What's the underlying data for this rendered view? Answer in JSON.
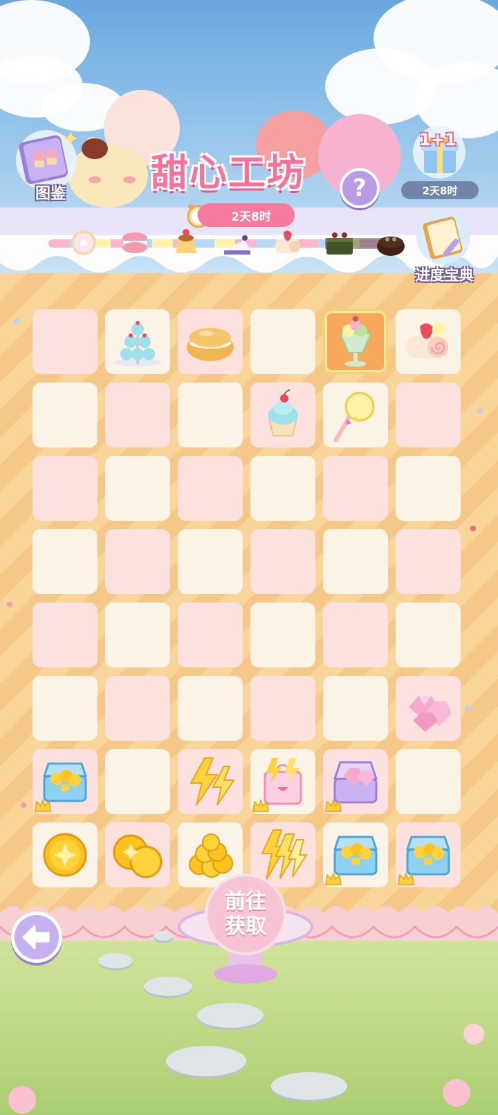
{
  "header": {
    "title": "甜心工坊",
    "help_icon": "?",
    "timer_text": "2天8时",
    "codex_label": "图鉴",
    "gift_label": "1+1",
    "gift_timer": "2天8时",
    "guide_label": "进度宝典"
  },
  "progress": {
    "stages": [
      "donut",
      "macaron",
      "pudding",
      "blueberry-cake",
      "strawberry-roll",
      "matcha-cake",
      "chocolate-cake"
    ],
    "unlocked_count": 5
  },
  "board": {
    "rows": [
      [
        {
          "c": "pink",
          "item": ""
        },
        {
          "c": "cream",
          "item": "cupcake-tower"
        },
        {
          "c": "pink",
          "item": "cream-puff"
        },
        {
          "c": "cream",
          "item": ""
        },
        {
          "c": "selected",
          "item": "parfait"
        },
        {
          "c": "cream",
          "item": "strawberry-roll"
        }
      ],
      [
        {
          "c": "cream",
          "item": ""
        },
        {
          "c": "pink",
          "item": ""
        },
        {
          "c": "cream",
          "item": ""
        },
        {
          "c": "pink",
          "item": "cupcake"
        },
        {
          "c": "cream",
          "item": "lollipop-wand"
        },
        {
          "c": "pink",
          "item": ""
        }
      ],
      [
        {
          "c": "pink",
          "item": ""
        },
        {
          "c": "cream",
          "item": ""
        },
        {
          "c": "pink",
          "item": ""
        },
        {
          "c": "cream",
          "item": ""
        },
        {
          "c": "pink",
          "item": ""
        },
        {
          "c": "cream",
          "item": ""
        }
      ],
      [
        {
          "c": "cream",
          "item": ""
        },
        {
          "c": "pink",
          "item": ""
        },
        {
          "c": "cream",
          "item": ""
        },
        {
          "c": "pink",
          "item": ""
        },
        {
          "c": "cream",
          "item": ""
        },
        {
          "c": "pink",
          "item": ""
        }
      ],
      [
        {
          "c": "pink",
          "item": ""
        },
        {
          "c": "cream",
          "item": ""
        },
        {
          "c": "pink",
          "item": ""
        },
        {
          "c": "cream",
          "item": ""
        },
        {
          "c": "pink",
          "item": ""
        },
        {
          "c": "cream",
          "item": ""
        }
      ],
      [
        {
          "c": "cream",
          "item": ""
        },
        {
          "c": "pink",
          "item": ""
        },
        {
          "c": "cream",
          "item": ""
        },
        {
          "c": "pink",
          "item": ""
        },
        {
          "c": "cream",
          "item": ""
        },
        {
          "c": "pink",
          "item": "pink-gems"
        }
      ],
      [
        {
          "c": "pink",
          "item": "coin-chest",
          "crown": true
        },
        {
          "c": "cream",
          "item": ""
        },
        {
          "c": "pink",
          "item": "energy-bolts"
        },
        {
          "c": "cream",
          "item": "energy-bag",
          "crown": true
        },
        {
          "c": "pink",
          "item": "gem-box",
          "crown": true
        },
        {
          "c": "cream",
          "item": ""
        }
      ],
      [
        {
          "c": "cream",
          "item": "coin"
        },
        {
          "c": "pink",
          "item": "two-coins"
        },
        {
          "c": "cream",
          "item": "coin-pile"
        },
        {
          "c": "pink",
          "item": "energy-bundle"
        },
        {
          "c": "cream",
          "item": "coin-chest",
          "crown": true
        },
        {
          "c": "pink",
          "item": "coin-chest",
          "crown": true
        }
      ]
    ]
  },
  "footer": {
    "go_line1": "前往",
    "go_line2": "获取",
    "back_icon": "back-arrow-icon"
  },
  "colors": {
    "title_pink": "#fb6f9b",
    "timer_pink": "#f8799e",
    "help_purple": "#b79be6",
    "cell_pink": "#fde1df",
    "cell_cream": "#fbf3e6",
    "cell_selected": "#f8a85a"
  }
}
